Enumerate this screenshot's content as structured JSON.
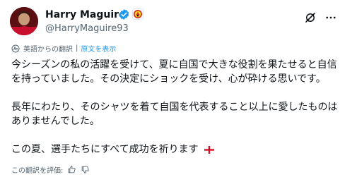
{
  "profile": {
    "display_name": "Harry Maguire",
    "handle": "@HarryMaguire93"
  },
  "translation": {
    "source_label": "英語からの翻訳",
    "separator": "|",
    "show_original": "原文を表示"
  },
  "tweet": {
    "paragraphs": [
      [
        "今シーズンの私の活躍を受けて、夏に自国で大きな役割を果たせると自信",
        "を持っていました。その決定にショックを受け、心が砕ける思いです。"
      ],
      [
        "長年にわたり、そのシャツを着て自国を代表すること以上に愛したものは",
        "ありませんでした。"
      ],
      [
        "この夏、選手たちにすべて成功を祈ります"
      ]
    ],
    "emoji": "england-flag"
  },
  "rating": {
    "label": "この翻訳を評価:"
  },
  "icons": {
    "verified": "verified-badge-icon",
    "affiliate": "club-crest-icon",
    "grok": "grok-icon",
    "more": "more-icon"
  },
  "colors": {
    "accent": "#1d9bf0",
    "text": "#0f1419",
    "muted": "#536471"
  }
}
